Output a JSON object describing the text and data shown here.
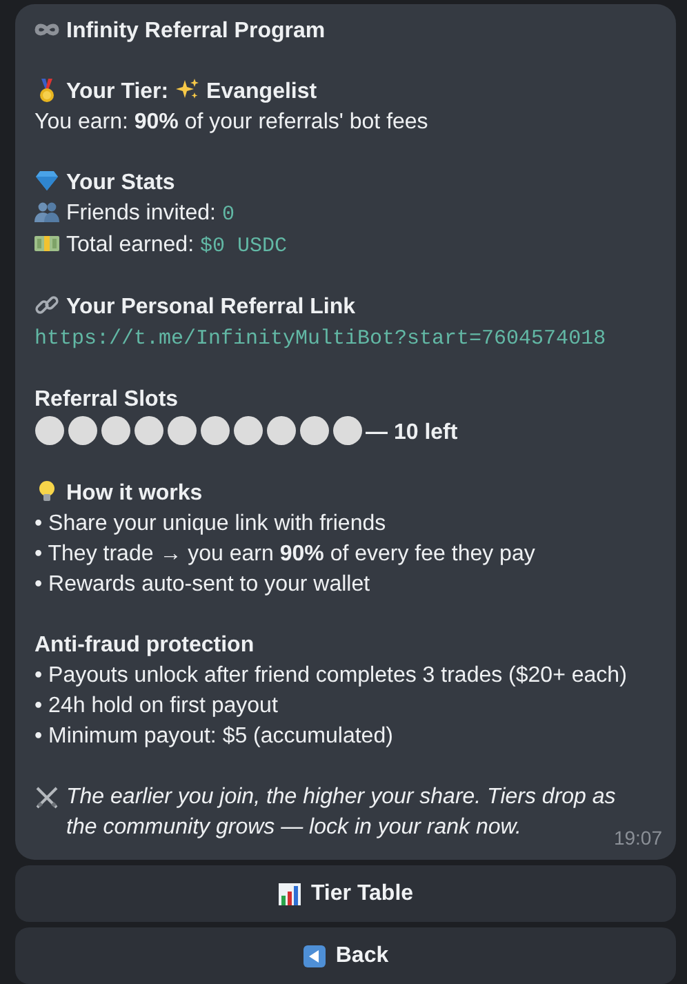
{
  "message": {
    "blocks": [
      {
        "lines": [
          {
            "kind": "heading",
            "parts": [
              {
                "kind": "icon"
              },
              {
                "kind": "text",
                "text": "Infinity Referral Program"
              }
            ]
          }
        ]
      },
      {
        "lines": [
          {
            "kind": "heading",
            "parts": [
              {
                "kind": "icon"
              },
              {
                "kind": "text",
                "text": "Your Tier:"
              },
              {
                "kind": "icon"
              },
              {
                "kind": "text",
                "text": "Evangelist"
              }
            ]
          },
          {
            "kind": "body",
            "parts": [
              {
                "kind": "text",
                "text": "You earn: **90%** of your referrals' bot fees"
              }
            ]
          }
        ]
      },
      {
        "lines": [
          {
            "kind": "heading",
            "parts": [
              {
                "kind": "icon"
              },
              {
                "kind": "text",
                "text": "Your Stats"
              }
            ]
          },
          {
            "kind": "body",
            "parts": [
              {
                "kind": "icon"
              },
              {
                "kind": "text",
                "text": "Friends invited:"
              },
              {
                "kind": "code",
                "text": "0"
              }
            ]
          },
          {
            "kind": "body",
            "parts": [
              {
                "kind": "icon"
              },
              {
                "kind": "text",
                "text": "Total earned:"
              },
              {
                "kind": "code",
                "text": "$0 USDC"
              }
            ]
          }
        ]
      },
      {
        "lines": [
          {
            "kind": "heading",
            "parts": [
              {
                "kind": "icon"
              },
              {
                "kind": "text",
                "text": "Your Personal Referral Link"
              }
            ]
          },
          {
            "kind": "body",
            "parts": [
              {
                "kind": "link",
                "text": "https://t.me/InfinityMultiBot?start=7604574018"
              }
            ]
          }
        ]
      },
      {
        "lines": [
          {
            "kind": "heading",
            "parts": [
              {
                "kind": "text",
                "text": "Referral Slots"
              }
            ]
          },
          {
            "kind": "body",
            "parts": [
              {
                "kind": "slot"
              },
              {
                "kind": "slot"
              },
              {
                "kind": "slot"
              },
              {
                "kind": "slot"
              },
              {
                "kind": "slot"
              },
              {
                "kind": "slot"
              },
              {
                "kind": "slot"
              },
              {
                "kind": "slot"
              },
              {
                "kind": "slot"
              },
              {
                "kind": "slot"
              },
              {
                "kind": "text",
                "text": "**— 10 left**"
              }
            ]
          }
        ]
      },
      {
        "lines": [
          {
            "kind": "heading",
            "parts": [
              {
                "kind": "icon"
              },
              {
                "kind": "text",
                "text": "How it works"
              }
            ]
          },
          {
            "kind": "body",
            "parts": [
              {
                "kind": "text",
                "text": "• Share your unique link with friends"
              }
            ]
          },
          {
            "kind": "body",
            "parts": [
              {
                "kind": "text",
                "text": "• They trade → you earn **90%** of every fee they pay"
              }
            ]
          },
          {
            "kind": "body",
            "parts": [
              {
                "kind": "text",
                "text": "• Rewards auto-sent to your wallet"
              }
            ]
          }
        ]
      },
      {
        "lines": [
          {
            "kind": "heading",
            "parts": [
              {
                "kind": "text",
                "text": "Anti-fraud protection"
              }
            ]
          },
          {
            "kind": "body",
            "parts": [
              {
                "kind": "text",
                "text": "• Payouts unlock after friend completes 3 trades ($20+ each)"
              }
            ]
          },
          {
            "kind": "body",
            "parts": [
              {
                "kind": "text",
                "text": "• 24h hold on first payout"
              }
            ]
          },
          {
            "kind": "body",
            "parts": [
              {
                "kind": "text",
                "text": "• Minimum payout: $5 (accumulated)"
              }
            ]
          }
        ]
      },
      {
        "lines": [
          {
            "kind": "italic",
            "parts": [
              {
                "kind": "icon"
              },
              {
                "kind": "text",
                "text": "The earlier you join, the higher your share. Tiers drop as the community grows — lock in your rank now."
              }
            ]
          }
        ]
      }
    ],
    "time": "19:07"
  },
  "buttons": [
    {
      "label": "Tier Table"
    },
    {
      "label": "Back"
    }
  ]
}
